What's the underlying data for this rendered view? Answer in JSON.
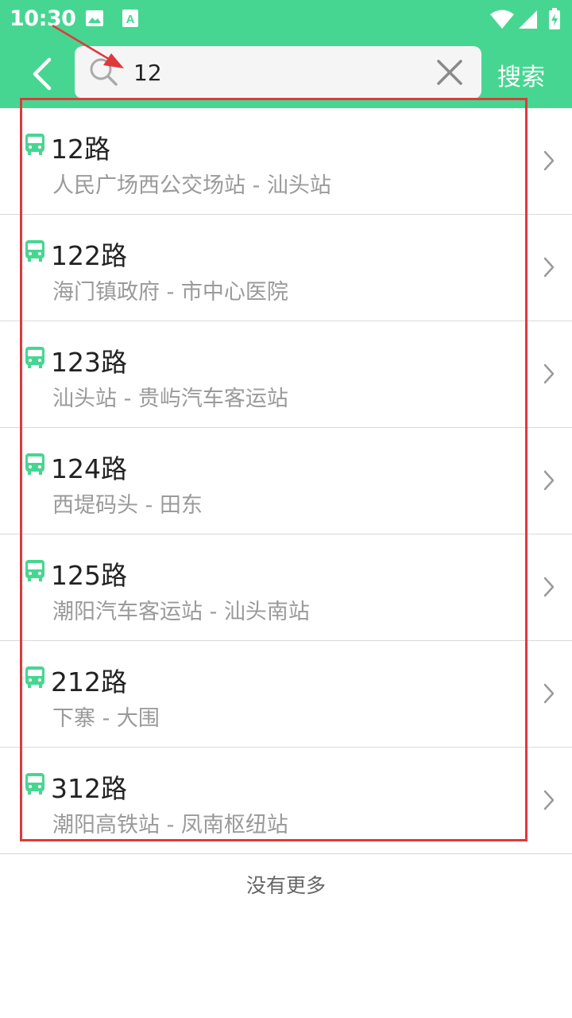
{
  "status_bar": {
    "time": "10:30",
    "icons": [
      "image-icon",
      "a-app-icon",
      "wifi-icon",
      "signal-icon",
      "battery-charging-icon"
    ]
  },
  "header": {
    "back_icon": "chevron-left-icon",
    "search_value": "12",
    "clear_icon": "close-icon",
    "search_button": "搜索"
  },
  "routes": [
    {
      "name": "12路",
      "stops": "人民广场西公交场站 - 汕头站"
    },
    {
      "name": "122路",
      "stops": "海门镇政府 - 市中心医院"
    },
    {
      "name": "123路",
      "stops": "汕头站 - 贵屿汽车客运站"
    },
    {
      "name": "124路",
      "stops": "西堤码头 - 田东"
    },
    {
      "name": "125路",
      "stops": "潮阳汽车客运站 - 汕头南站"
    },
    {
      "name": "212路",
      "stops": "下寨 - 大围"
    },
    {
      "name": "312路",
      "stops": "潮阳高铁站 - 凤南枢纽站"
    }
  ],
  "footer": "没有更多",
  "colors": {
    "brand_green": "#47d691",
    "annotation_red": "#e0393b"
  }
}
